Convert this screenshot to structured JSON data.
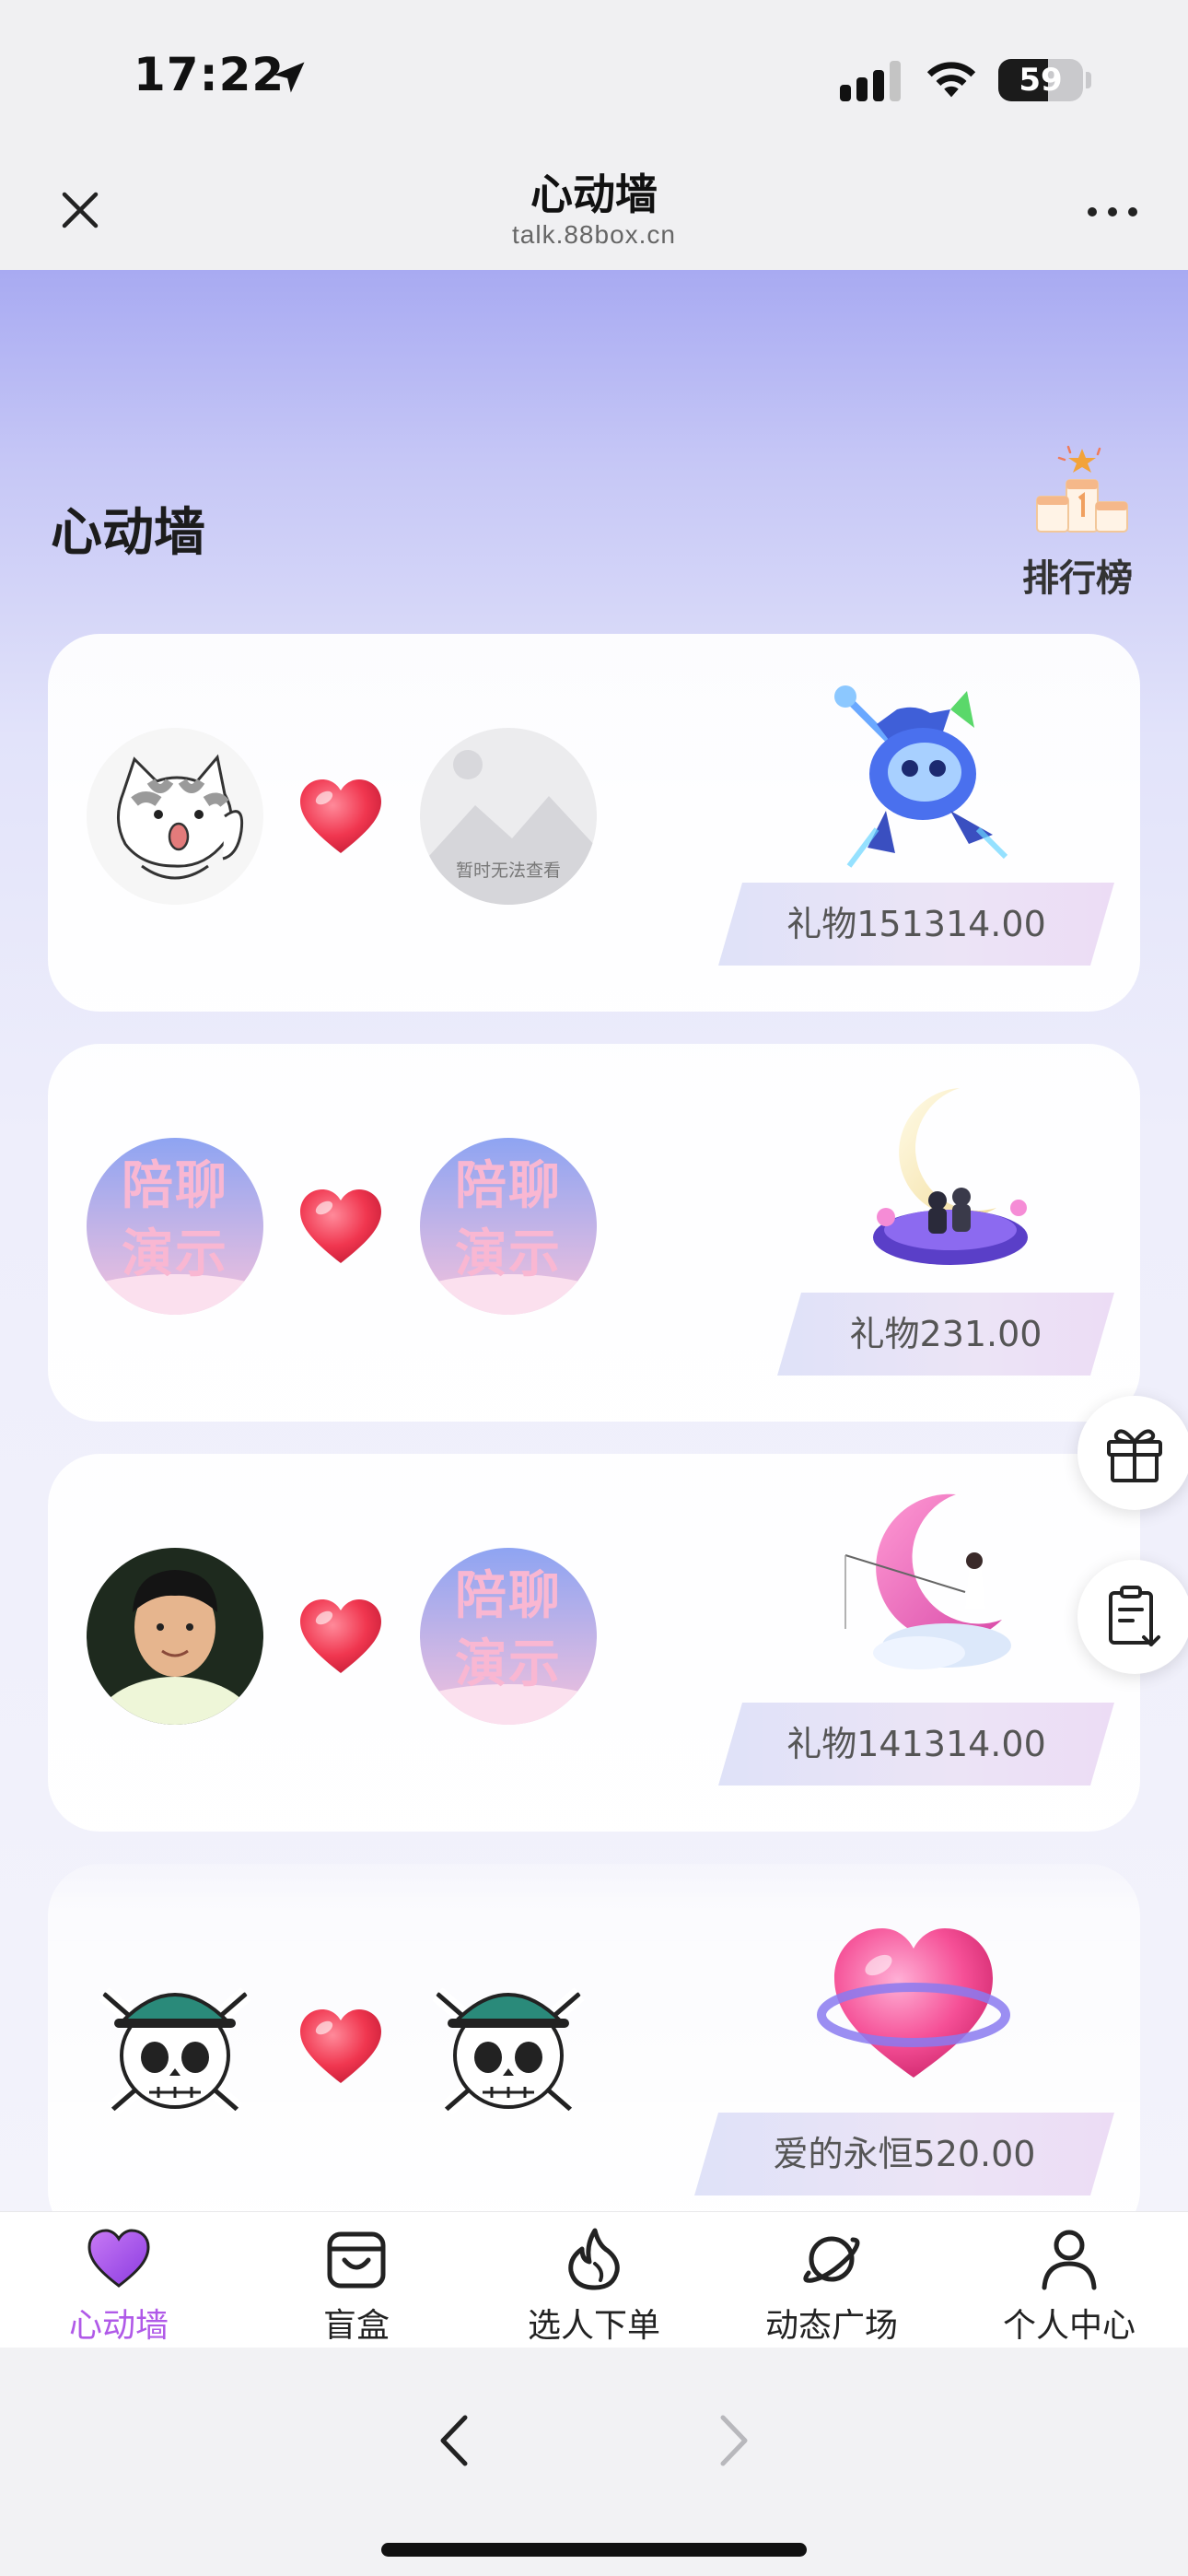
{
  "status_bar": {
    "time": "17:22",
    "battery": "59",
    "battery_level_percent": 59,
    "icons": [
      "location-arrow-icon",
      "cellular-signal-icon",
      "wifi-icon",
      "battery-icon"
    ]
  },
  "browser": {
    "title": "心动墙",
    "url": "talk.88box.cn",
    "icons": [
      "close-icon",
      "more-icon",
      "back-chevron-icon",
      "forward-chevron-icon"
    ]
  },
  "page": {
    "section_title": "心动墙",
    "ranking_label": "排行榜",
    "ranking_icon": "podium-icon"
  },
  "cards": [
    {
      "from_avatar": "cat-avatar",
      "to_avatar": "image-unavailable-avatar",
      "to_avatar_caption": "暂时无法查看",
      "gift_icon": "robot-cat-gift",
      "gift_text": "礼物151314.00"
    },
    {
      "from_avatar": "demo-avatar",
      "to_avatar": "demo-avatar",
      "from_avatar_caption": "陪聊演示",
      "to_avatar_caption": "陪聊演示",
      "gift_icon": "moon-couple-gift",
      "gift_text": "礼物231.00"
    },
    {
      "from_avatar": "person-avatar",
      "to_avatar": "demo-avatar",
      "to_avatar_caption": "陪聊演示",
      "gift_icon": "moon-fishing-gift",
      "gift_text": "礼物141314.00"
    },
    {
      "from_avatar": "skull-avatar",
      "to_avatar": "skull-avatar",
      "gift_icon": "heart-ring-gift",
      "gift_text": "爱的永恒520.00"
    }
  ],
  "floating_buttons": [
    "gift-icon",
    "clipboard-download-icon"
  ],
  "tabs": [
    {
      "label": "心动墙",
      "icon": "heart-icon",
      "active": true
    },
    {
      "label": "盲盒",
      "icon": "bag-icon",
      "active": false
    },
    {
      "label": "选人下单",
      "icon": "flame-icon",
      "active": false
    },
    {
      "label": "动态广场",
      "icon": "planet-icon",
      "active": false
    },
    {
      "label": "个人中心",
      "icon": "person-icon",
      "active": false
    }
  ],
  "colors": {
    "accent": "#b05ae8",
    "heart": "#f0364f",
    "header_gradient_top": "#a8aaf2"
  }
}
